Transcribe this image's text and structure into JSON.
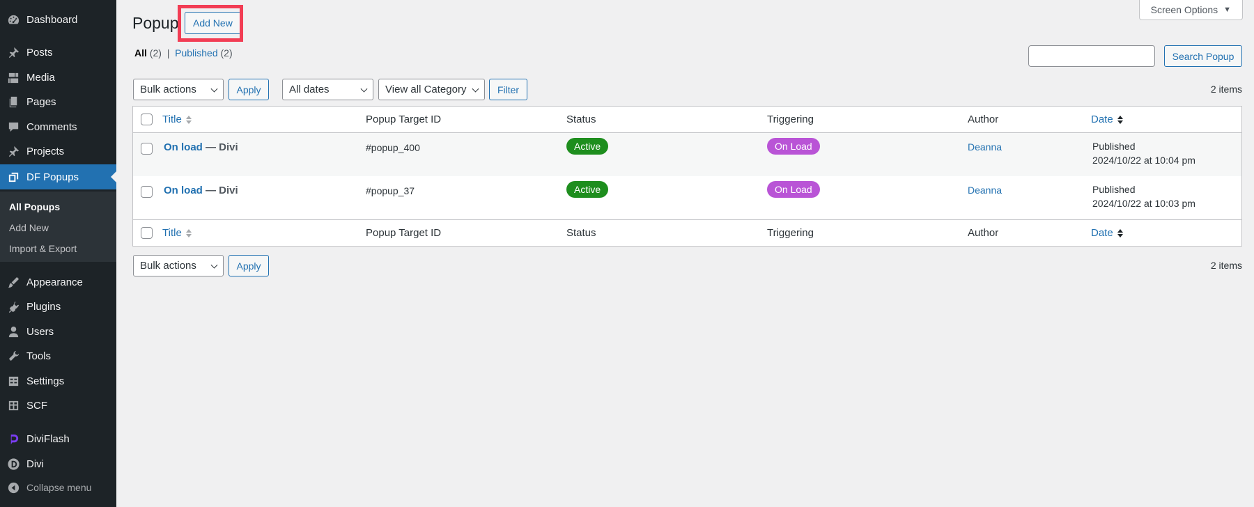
{
  "sidebar": {
    "items": [
      {
        "label": "Dashboard",
        "icon": "dashboard-icon"
      },
      {
        "label": "Posts",
        "icon": "pin-icon"
      },
      {
        "label": "Media",
        "icon": "media-icon"
      },
      {
        "label": "Pages",
        "icon": "pages-icon"
      },
      {
        "label": "Comments",
        "icon": "comment-icon"
      },
      {
        "label": "Projects",
        "icon": "pin-icon"
      },
      {
        "label": "DF Popups",
        "icon": "popup-icon"
      },
      {
        "label": "Appearance",
        "icon": "brush-icon"
      },
      {
        "label": "Plugins",
        "icon": "plugin-icon"
      },
      {
        "label": "Users",
        "icon": "user-icon"
      },
      {
        "label": "Tools",
        "icon": "wrench-icon"
      },
      {
        "label": "Settings",
        "icon": "settings-icon"
      },
      {
        "label": "SCF",
        "icon": "grid-icon"
      },
      {
        "label": "DiviFlash",
        "icon": "diviflash-icon"
      },
      {
        "label": "Divi",
        "icon": "divi-icon"
      },
      {
        "label": "Collapse menu",
        "icon": "collapse-icon"
      }
    ],
    "submenu": [
      "All Popups",
      "Add New",
      "Import & Export"
    ]
  },
  "header": {
    "screen_options": "Screen Options",
    "page_title": "Popup",
    "add_new": "Add New"
  },
  "views": {
    "all_label": "All",
    "all_count": "(2)",
    "separator": "|",
    "published_label": "Published",
    "published_count": "(2)"
  },
  "search": {
    "button": "Search Popup"
  },
  "tablenav": {
    "bulk_actions": "Bulk actions",
    "apply": "Apply",
    "all_dates": "All dates",
    "category": "View all Category",
    "filter": "Filter",
    "items_count": "2 items"
  },
  "table": {
    "columns": [
      "Title",
      "Popup Target ID",
      "Status",
      "Triggering",
      "Author",
      "Date"
    ],
    "rows": [
      {
        "title": "On load",
        "suffix": " — Divi",
        "target_id": "#popup_400",
        "status": "Active",
        "trigger": "On Load",
        "author": "Deanna",
        "date_status": "Published",
        "date": "2024/10/22 at 10:04 pm"
      },
      {
        "title": "On load",
        "suffix": " — Divi",
        "target_id": "#popup_37",
        "status": "Active",
        "trigger": "On Load",
        "author": "Deanna",
        "date_status": "Published",
        "date": "2024/10/22 at 10:03 pm"
      }
    ]
  },
  "colors": {
    "sidebar_bg": "#1d2327",
    "accent": "#2271b1",
    "status_active": "#1e8e1e",
    "trigger_badge": "#b954d6",
    "highlight": "#f23d54"
  }
}
